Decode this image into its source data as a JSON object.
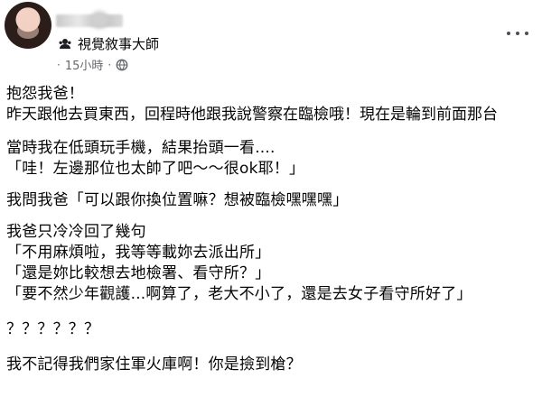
{
  "post": {
    "group_name": "視覺敘事大師",
    "time": "15小時",
    "separator": "·",
    "lines": [
      "抱怨我爸！",
      "昨天跟他去買東西，回程時他跟我說警察在臨檢哦！現在是輪到前面那台",
      "當時我在低頭玩手機，結果抬頭一看....",
      "「哇！左邊那位也太帥了吧～～很ok耶！」",
      "我問我爸「可以跟你換位置嘛？想被臨檢嘿嘿嘿」",
      "我爸只冷冷回了幾句",
      "「不用麻煩啦，我等等載妳去派出所」",
      "「還是妳比較想去地檢署、看守所？」",
      "「要不然少年觀護...啊算了，老大不小了，還是去女子看守所好了」",
      "？？？？？？",
      "我不記得我們家住軍火庫啊！你是撿到槍？"
    ]
  },
  "icons": {
    "group": "group-icon",
    "privacy": "globe-icon",
    "more": "more-options-icon"
  },
  "colors": {
    "text": "#050505",
    "secondary_text": "#65676b",
    "background": "#ffffff"
  }
}
